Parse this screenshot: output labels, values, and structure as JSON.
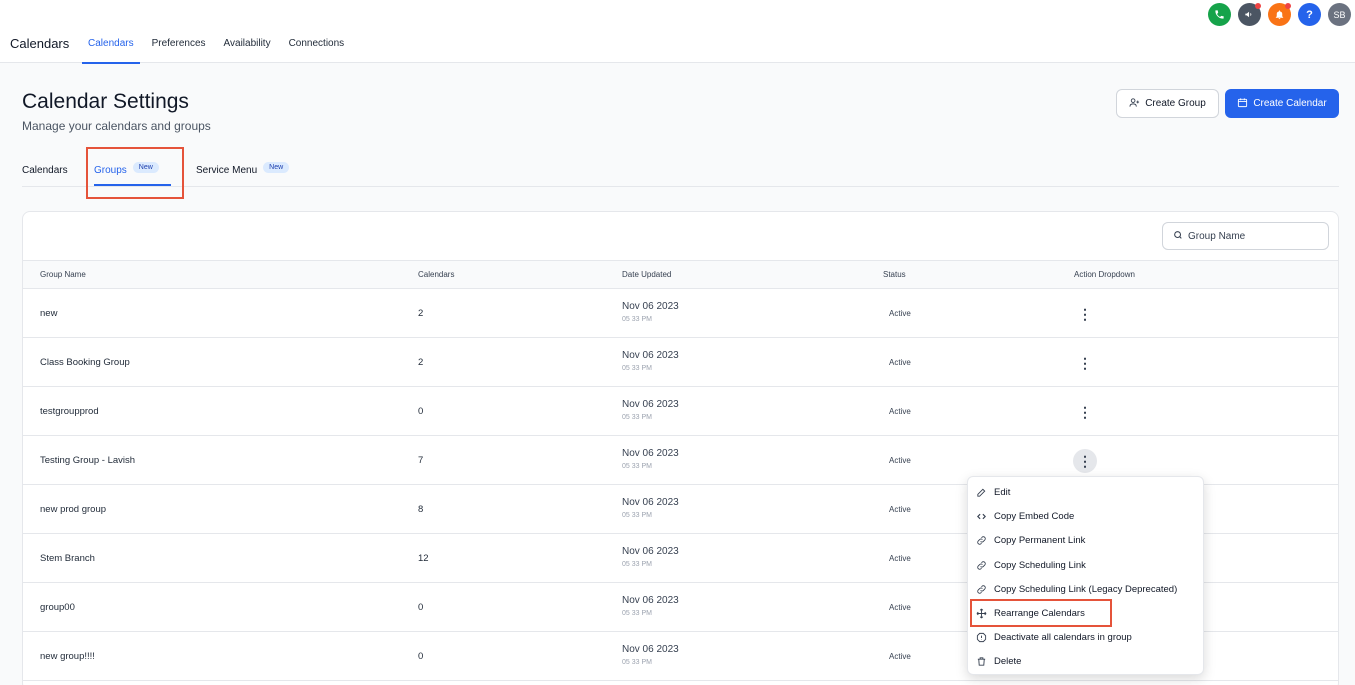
{
  "app": {
    "title": "Calendars"
  },
  "nav": [
    {
      "label": "Calendars",
      "active": true
    },
    {
      "label": "Preferences",
      "active": false
    },
    {
      "label": "Availability",
      "active": false
    },
    {
      "label": "Connections",
      "active": false
    }
  ],
  "top_icons": {
    "avatar_initials": "SB",
    "help": "?"
  },
  "header": {
    "title": "Calendar Settings",
    "subtitle": "Manage your calendars and groups",
    "create_group_label": "Create Group",
    "create_calendar_label": "Create Calendar"
  },
  "tabs": [
    {
      "label": "Calendars"
    },
    {
      "label": "Groups",
      "badge": "New",
      "active": true
    },
    {
      "label": "Service Menu",
      "badge": "New"
    }
  ],
  "search": {
    "placeholder": "Group Name"
  },
  "table": {
    "headers": [
      "Group Name",
      "Calendars",
      "Date Updated",
      "Status",
      "Action Dropdown"
    ],
    "rows": [
      {
        "name": "new",
        "calendars": "2",
        "date": "Nov 06 2023",
        "time": "05 33 PM",
        "status": "Active"
      },
      {
        "name": "Class Booking Group",
        "calendars": "2",
        "date": "Nov 06 2023",
        "time": "05 33 PM",
        "status": "Active"
      },
      {
        "name": "testgroupprod",
        "calendars": "0",
        "date": "Nov 06 2023",
        "time": "05 33 PM",
        "status": "Active"
      },
      {
        "name": "Testing Group - Lavish",
        "calendars": "7",
        "date": "Nov 06 2023",
        "time": "05 33 PM",
        "status": "Active"
      },
      {
        "name": "new prod group",
        "calendars": "8",
        "date": "Nov 06 2023",
        "time": "05 33 PM",
        "status": "Active"
      },
      {
        "name": "Stem Branch",
        "calendars": "12",
        "date": "Nov 06 2023",
        "time": "05 33 PM",
        "status": "Active"
      },
      {
        "name": "group00",
        "calendars": "0",
        "date": "Nov 06 2023",
        "time": "05 33 PM",
        "status": "Active"
      },
      {
        "name": "new group!!!!",
        "calendars": "0",
        "date": "Nov 06 2023",
        "time": "05 33 PM",
        "status": "Active"
      }
    ]
  },
  "action_menu": {
    "items": [
      {
        "label": "Edit",
        "icon": "pencil-icon"
      },
      {
        "label": "Copy Embed Code",
        "icon": "code-icon"
      },
      {
        "label": "Copy Permanent Link",
        "icon": "link-icon"
      },
      {
        "label": "Copy Scheduling Link",
        "icon": "link-icon"
      },
      {
        "label": "Copy Scheduling Link (Legacy Deprecated)",
        "icon": "link-icon"
      },
      {
        "label": "Rearrange Calendars",
        "icon": "move-icon"
      },
      {
        "label": "Deactivate all calendars in group",
        "icon": "deactivate-icon"
      },
      {
        "label": "Delete",
        "icon": "trash-icon"
      }
    ]
  },
  "colors": {
    "accent": "#2563eb",
    "highlight": "#e5533a"
  }
}
